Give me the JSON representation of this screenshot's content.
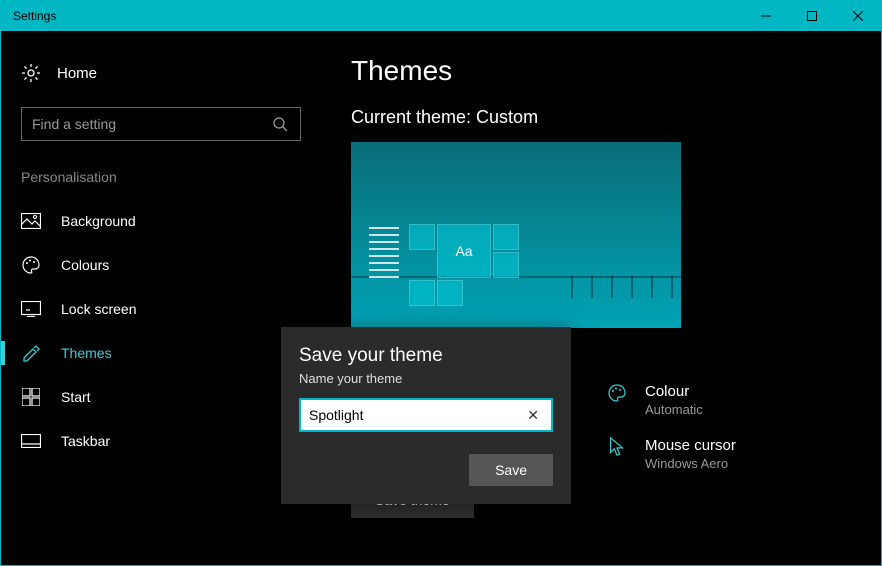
{
  "titlebar": {
    "title": "Settings"
  },
  "sidebar": {
    "home": "Home",
    "search_placeholder": "Find a setting",
    "section": "Personalisation",
    "items": [
      {
        "label": "Background"
      },
      {
        "label": "Colours"
      },
      {
        "label": "Lock screen"
      },
      {
        "label": "Themes"
      },
      {
        "label": "Start"
      },
      {
        "label": "Taskbar"
      }
    ]
  },
  "main": {
    "title": "Themes",
    "subtitle": "Current theme: Custom",
    "preview_sample": "Aa",
    "options": {
      "colour": {
        "label": "Colour",
        "value": "Automatic"
      },
      "cursor": {
        "label": "Mouse cursor",
        "value": "Windows Aero"
      }
    },
    "save_theme": "Save theme"
  },
  "dialog": {
    "title": "Save your theme",
    "subtitle": "Name your theme",
    "value": "Spotlight",
    "save": "Save"
  }
}
